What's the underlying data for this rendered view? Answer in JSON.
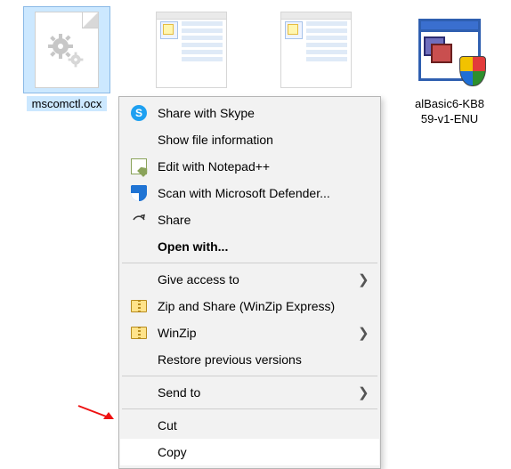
{
  "files": [
    {
      "name": "mscomctl.ocx"
    },
    {
      "name": ""
    },
    {
      "name": ""
    },
    {
      "name_line1": "alBasic6-KB8",
      "name_line2": "59-v1-ENU"
    }
  ],
  "menu": {
    "skype": "Share with Skype",
    "info": "Show file information",
    "npp": "Edit with Notepad++",
    "defender": "Scan with Microsoft Defender...",
    "share": "Share",
    "openwith": "Open with...",
    "giveaccess": "Give access to",
    "zipshare": "Zip and Share (WinZip Express)",
    "winzip": "WinZip",
    "restore": "Restore previous versions",
    "sendto": "Send to",
    "cut": "Cut",
    "copy": "Copy"
  },
  "colors": {
    "selection": "#cce8ff"
  }
}
